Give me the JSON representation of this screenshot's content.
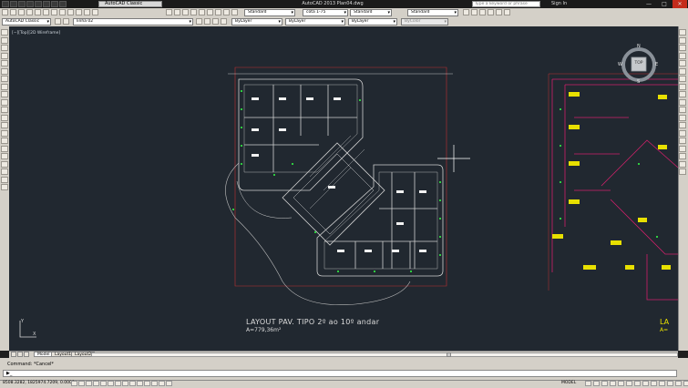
{
  "titlebar": {
    "workspace": "AutoCAD Classic",
    "app_title": "AutoCAD 2013    Plan04.dwg",
    "help_placeholder": "Type a keyword or phrase",
    "signin": "Sign In",
    "min": "—",
    "max": "□",
    "close": "✕"
  },
  "toolbar1": {
    "textstyle": "Standard",
    "dimstyle": "cota 1-75",
    "tablestyle": "Standard",
    "mleaderstyle": "Standard"
  },
  "toolbar2": {
    "workspace": "AutoCAD Classic",
    "layer": "linha 02",
    "color": "ByLayer",
    "linetype": "ByLayer",
    "lineweight": "ByLayer",
    "plotstyle": "ByColor"
  },
  "viewport": {
    "label": "[−][Top][2D Wireframe]",
    "viewcube": {
      "n": "N",
      "s": "S",
      "w": "W",
      "e": "E",
      "top": "TOP"
    },
    "ucs": {
      "x": "X",
      "y": "Y"
    }
  },
  "drawing": {
    "title": "LAYOUT PAV. TIPO 2º ao 10º andar",
    "area": "A=779,36m²",
    "title_partial": "LA",
    "area_partial": "A="
  },
  "tabs": {
    "model": "Model",
    "layout1": "Layout1",
    "layout2": "Layout2"
  },
  "command": {
    "history": "Command:  *Cancel*",
    "prompt": "▶_"
  },
  "status": {
    "coords": "8508.3282, 1825974.7209, 0.0000",
    "model": "MODEL"
  }
}
